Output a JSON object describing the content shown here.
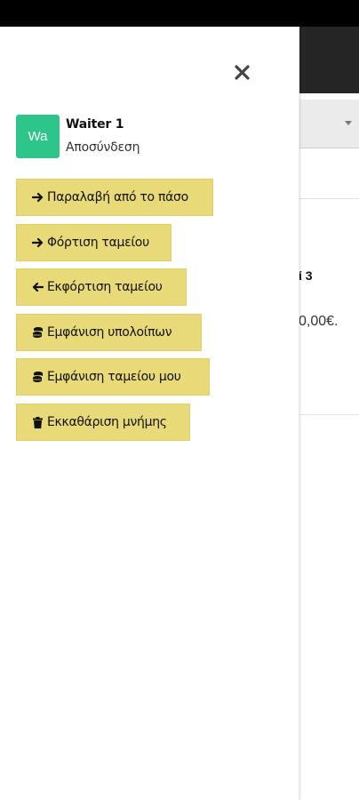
{
  "background": {
    "table_label": "ί 3",
    "amount": "0,00€."
  },
  "drawer": {
    "user": {
      "avatar_initials": "Wa",
      "name": "Waiter 1",
      "logout_label": "Αποσύνδεση"
    },
    "menu": [
      {
        "label": "Παραλαβή από το πάσο",
        "icon": "arrow-right-icon"
      },
      {
        "label": "Φόρτιση ταμείου",
        "icon": "arrow-right-icon"
      },
      {
        "label": "Εκφόρτιση ταμείου",
        "icon": "arrow-left-icon"
      },
      {
        "label": "Εμφάνιση υπολοίπων",
        "icon": "coins-icon"
      },
      {
        "label": "Εμφάνιση ταμείου μου",
        "icon": "coins-icon"
      },
      {
        "label": "Εκκαθάριση μνήμης",
        "icon": "trash-icon"
      }
    ]
  },
  "colors": {
    "avatar_bg": "#2ec58a",
    "menu_button_bg": "#e8da78",
    "header_bg": "#252525"
  }
}
